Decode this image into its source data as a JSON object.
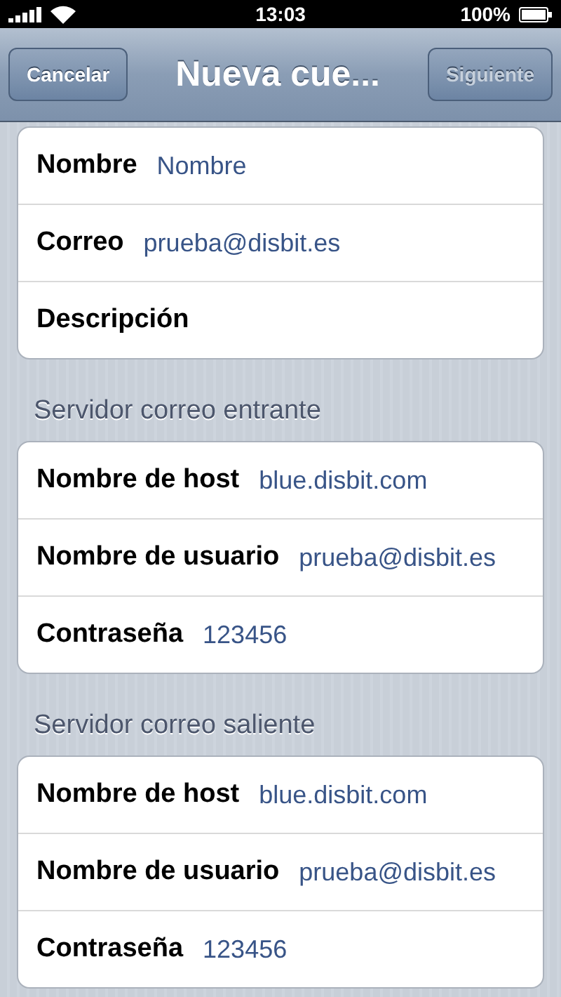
{
  "status_bar": {
    "time": "13:03",
    "battery": "100%"
  },
  "nav_bar": {
    "title": "Nueva cue...",
    "left_button": {
      "label": "Cancelar",
      "disabled": false
    },
    "right_button": {
      "label": "Siguiente",
      "disabled": true
    }
  },
  "sections": [
    {
      "rows": [
        {
          "label": "Nombre",
          "value": "Nombre"
        },
        {
          "label": "Correo",
          "value": "prueba@disbit.es"
        },
        {
          "label": "Descripción"
        }
      ]
    },
    {
      "header": "Servidor correo entrante",
      "rows": [
        {
          "label": "Nombre de host",
          "value": "blue.disbit.com"
        },
        {
          "label": "Nombre de usuario",
          "value": "prueba@disbit.es"
        },
        {
          "label": "Contraseña",
          "value": "123456"
        }
      ]
    },
    {
      "header": "Servidor correo saliente",
      "rows": [
        {
          "label": "Nombre de host",
          "value": "blue.disbit.com"
        },
        {
          "label": "Nombre de usuario",
          "value": "prueba@disbit.es"
        },
        {
          "label": "Contraseña",
          "value": "123456"
        }
      ]
    }
  ]
}
